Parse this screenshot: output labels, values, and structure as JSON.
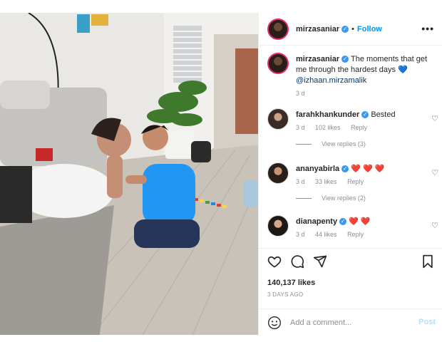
{
  "post": {
    "author": "mirzasaniar",
    "follow_label": "Follow",
    "separator": "•",
    "more_label": "•••",
    "caption_prefix": "The moments that get me through the hardest days ",
    "caption_heart": "💙",
    "caption_mention": "@izhaan.mirzamalik",
    "caption_time": "3 d"
  },
  "comments": [
    {
      "user": "farahkhankunder",
      "text": "Bested",
      "time": "3 d",
      "likes": "102 likes",
      "reply": "Reply",
      "view_replies": "View replies (3)"
    },
    {
      "user": "ananyabirla",
      "text": "❤️ ❤️ ❤️",
      "time": "3 d",
      "likes": "33 likes",
      "reply": "Reply",
      "view_replies": "View replies (2)"
    },
    {
      "user": "dianapenty",
      "text": "❤️ ❤️",
      "time": "3 d",
      "likes": "44 likes",
      "reply": "Reply"
    }
  ],
  "footer": {
    "likes": "140,137 likes",
    "date": "3 DAYS AGO",
    "comment_placeholder": "Add a comment...",
    "post_label": "Post"
  },
  "icons": {
    "verified": "verified-badge-icon",
    "like": "heart-icon",
    "comment": "comment-bubble-icon",
    "share": "paper-plane-icon",
    "save": "bookmark-icon",
    "emoji": "smiley-icon",
    "more": "ellipsis-icon"
  },
  "colors": {
    "link": "#0095f6",
    "mention": "#00376b",
    "muted": "#8e8e8e",
    "story_ring": "#e1306c",
    "heart_red": "#ed4956"
  }
}
